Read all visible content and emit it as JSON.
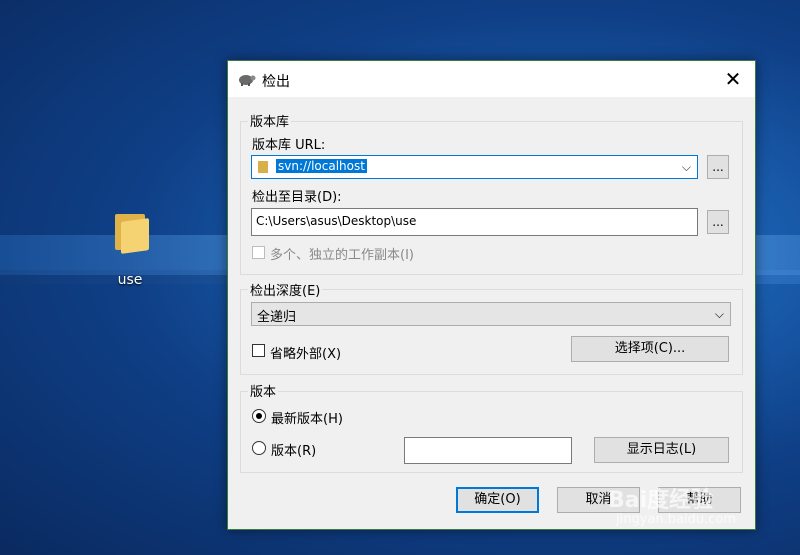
{
  "desktop": {
    "icon_label": "use"
  },
  "dialog": {
    "title": "检出",
    "close_symbol": "✕",
    "repository": {
      "group_label": "版本库",
      "url_label": "版本库 URL:",
      "url_value": "svn://localhost",
      "url_browse": "...",
      "checkout_dir_label": "检出至目录(D):",
      "checkout_dir_value": "C:\\Users\\asus\\Desktop\\use",
      "dir_browse": "...",
      "multiple_label": "多个、独立的工作副本(I)"
    },
    "depth": {
      "group_label": "检出深度(E)",
      "selected": "全递归",
      "omit_externals_label": "省略外部(X)",
      "choose_items_button": "选择项(C)..."
    },
    "revision": {
      "group_label": "版本",
      "head_label": "最新版本(H)",
      "revision_label": "版本(R)",
      "revision_value": "",
      "show_log_button": "显示日志(L)"
    },
    "buttons": {
      "ok": "确定(O)",
      "cancel": "取消",
      "help": "帮助"
    }
  },
  "watermark": {
    "main": "Bai度经验",
    "sub": "jingyan.baidu.com"
  },
  "colors": {
    "accent": "#0078d7",
    "dialog_bg": "#f0f0f0"
  }
}
